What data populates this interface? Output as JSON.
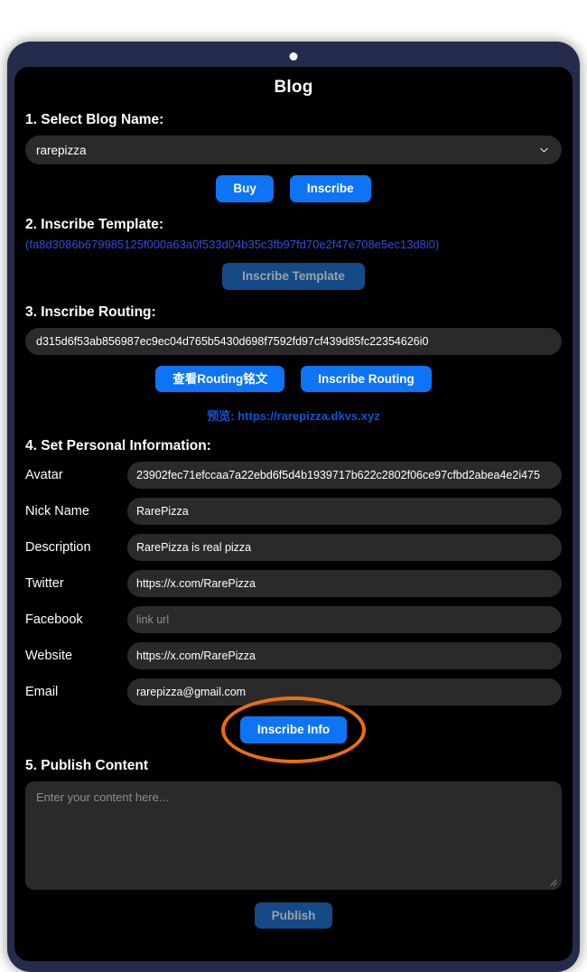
{
  "app": {
    "title": "Blog"
  },
  "sections": {
    "blog_name": {
      "heading": "1. Select Blog Name:",
      "selected": "rarepizza",
      "buy_label": "Buy",
      "inscribe_label": "Inscribe"
    },
    "template": {
      "heading": "2. Inscribe Template:",
      "hash": "(fa8d3086b679985125f000a63a0f533d04b35c3fb97fd70e2f47e708e5ec13d8i0)",
      "button_label": "Inscribe Template"
    },
    "routing": {
      "heading": "3. Inscribe Routing:",
      "value": "d315d6f53ab856987ec9ec04d765b5430d698f7592fd97cf439d85fc22354626i0",
      "view_label": "查看Routing铭文",
      "inscribe_label": "Inscribe Routing",
      "preview_label": "预览:",
      "preview_url": "https://rarepizza.dkvs.xyz"
    },
    "personal_info": {
      "heading": "4. Set Personal Information:",
      "fields": [
        {
          "label": "Avatar",
          "value": "23902fec71efccaa7a22ebd6f5d4b1939717b622c2802f06ce97cfbd2abea4e2i475",
          "placeholder": ""
        },
        {
          "label": "Nick Name",
          "value": "RarePizza",
          "placeholder": ""
        },
        {
          "label": "Description",
          "value": "RarePizza is real pizza",
          "placeholder": ""
        },
        {
          "label": "Twitter",
          "value": "https://x.com/RarePizza",
          "placeholder": ""
        },
        {
          "label": "Facebook",
          "value": "",
          "placeholder": "link url"
        },
        {
          "label": "Website",
          "value": "https://x.com/RarePizza",
          "placeholder": ""
        },
        {
          "label": "Email",
          "value": "rarepizza@gmail.com",
          "placeholder": ""
        }
      ],
      "inscribe_info_label": "Inscribe Info"
    },
    "publish": {
      "heading": "5. Publish Content",
      "placeholder": "Enter your content here...",
      "button_label": "Publish"
    }
  },
  "colors": {
    "accent_blue": "#0d74f5",
    "disabled_blue": "#144a85",
    "link_blue": "#0b55d6",
    "hash_blue": "#2f4ed8",
    "annotation_orange": "#ee6f0a",
    "screen_black": "#000000",
    "field_grey": "#2a2a2c",
    "frame_navy": "#252b4a"
  },
  "icons": {
    "chevron_down": "chevron-down-icon",
    "camera": "camera-dot-icon",
    "resize": "resize-grip-icon"
  }
}
